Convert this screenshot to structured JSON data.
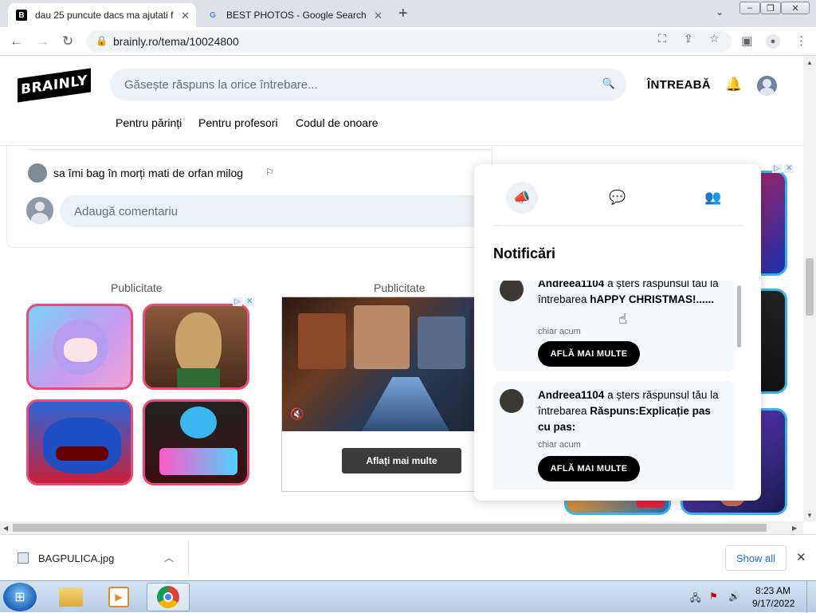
{
  "browser": {
    "tabs": [
      {
        "title": "dau 25 puncute dacs ma ajutati f",
        "favicon": "B"
      },
      {
        "title": "BEST PHOTOS - Google Search",
        "favicon": "G"
      }
    ],
    "new_tab": "+",
    "url": "brainly.ro/tema/10024800"
  },
  "header": {
    "logo": "BRAINLY",
    "search_placeholder": "Găsește răspuns la orice întrebare...",
    "ask_label": "ÎNTREABĂ",
    "nav": [
      "Pentru părinți",
      "Pentru profesori",
      "Codul de onoare"
    ]
  },
  "comment": {
    "text": "sa îmi bag în morți mati de orfan milog",
    "add_placeholder": "Adaugă comentariu"
  },
  "ads": {
    "label_left": "Publicitate",
    "label_center": "Publicitate",
    "button": "Aflați mai multe"
  },
  "notifications": {
    "title": "Notificări",
    "items": [
      {
        "user": "Andreea1104",
        "action": " a șters răspunsul tău la întrebarea ",
        "question": "hAPPY CHRISTMAS!......",
        "time": "chiar acum",
        "button": "AFLĂ MAI MULTE"
      },
      {
        "user": "Andreea1104",
        "action": " a șters răspunsul tău la întrebarea ",
        "question": "Răspuns:Explicație pas cu pas:",
        "time": "chiar acum",
        "button": "AFLĂ MAI MULTE"
      }
    ]
  },
  "downloads": {
    "file": "BAGPULICA.jpg",
    "show_all": "Show all"
  },
  "taskbar": {
    "time": "8:23 AM",
    "date": "9/17/2022"
  }
}
